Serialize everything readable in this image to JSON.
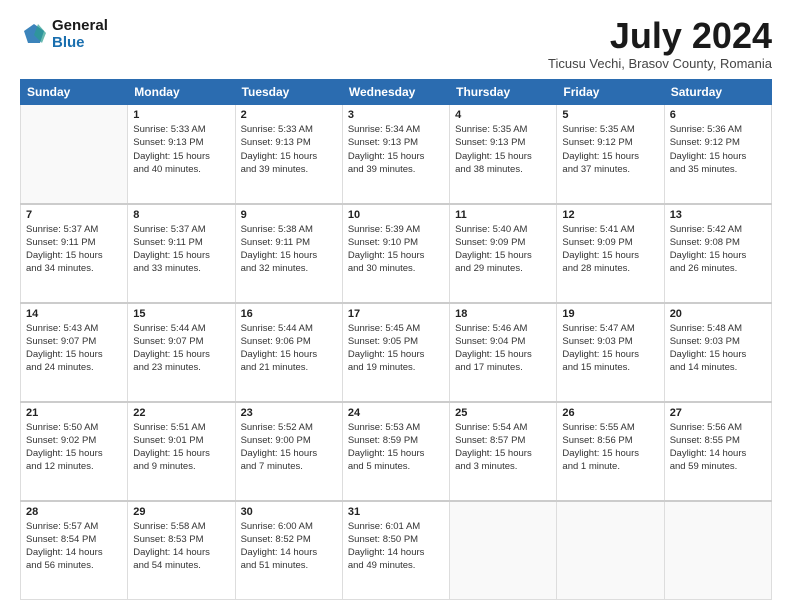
{
  "logo": {
    "general": "General",
    "blue": "Blue"
  },
  "title": "July 2024",
  "location": "Ticusu Vechi, Brasov County, Romania",
  "days_of_week": [
    "Sunday",
    "Monday",
    "Tuesday",
    "Wednesday",
    "Thursday",
    "Friday",
    "Saturday"
  ],
  "weeks": [
    [
      {
        "day": "",
        "content": ""
      },
      {
        "day": "1",
        "content": "Sunrise: 5:33 AM\nSunset: 9:13 PM\nDaylight: 15 hours\nand 40 minutes."
      },
      {
        "day": "2",
        "content": "Sunrise: 5:33 AM\nSunset: 9:13 PM\nDaylight: 15 hours\nand 39 minutes."
      },
      {
        "day": "3",
        "content": "Sunrise: 5:34 AM\nSunset: 9:13 PM\nDaylight: 15 hours\nand 39 minutes."
      },
      {
        "day": "4",
        "content": "Sunrise: 5:35 AM\nSunset: 9:13 PM\nDaylight: 15 hours\nand 38 minutes."
      },
      {
        "day": "5",
        "content": "Sunrise: 5:35 AM\nSunset: 9:12 PM\nDaylight: 15 hours\nand 37 minutes."
      },
      {
        "day": "6",
        "content": "Sunrise: 5:36 AM\nSunset: 9:12 PM\nDaylight: 15 hours\nand 35 minutes."
      }
    ],
    [
      {
        "day": "7",
        "content": "Sunrise: 5:37 AM\nSunset: 9:11 PM\nDaylight: 15 hours\nand 34 minutes."
      },
      {
        "day": "8",
        "content": "Sunrise: 5:37 AM\nSunset: 9:11 PM\nDaylight: 15 hours\nand 33 minutes."
      },
      {
        "day": "9",
        "content": "Sunrise: 5:38 AM\nSunset: 9:11 PM\nDaylight: 15 hours\nand 32 minutes."
      },
      {
        "day": "10",
        "content": "Sunrise: 5:39 AM\nSunset: 9:10 PM\nDaylight: 15 hours\nand 30 minutes."
      },
      {
        "day": "11",
        "content": "Sunrise: 5:40 AM\nSunset: 9:09 PM\nDaylight: 15 hours\nand 29 minutes."
      },
      {
        "day": "12",
        "content": "Sunrise: 5:41 AM\nSunset: 9:09 PM\nDaylight: 15 hours\nand 28 minutes."
      },
      {
        "day": "13",
        "content": "Sunrise: 5:42 AM\nSunset: 9:08 PM\nDaylight: 15 hours\nand 26 minutes."
      }
    ],
    [
      {
        "day": "14",
        "content": "Sunrise: 5:43 AM\nSunset: 9:07 PM\nDaylight: 15 hours\nand 24 minutes."
      },
      {
        "day": "15",
        "content": "Sunrise: 5:44 AM\nSunset: 9:07 PM\nDaylight: 15 hours\nand 23 minutes."
      },
      {
        "day": "16",
        "content": "Sunrise: 5:44 AM\nSunset: 9:06 PM\nDaylight: 15 hours\nand 21 minutes."
      },
      {
        "day": "17",
        "content": "Sunrise: 5:45 AM\nSunset: 9:05 PM\nDaylight: 15 hours\nand 19 minutes."
      },
      {
        "day": "18",
        "content": "Sunrise: 5:46 AM\nSunset: 9:04 PM\nDaylight: 15 hours\nand 17 minutes."
      },
      {
        "day": "19",
        "content": "Sunrise: 5:47 AM\nSunset: 9:03 PM\nDaylight: 15 hours\nand 15 minutes."
      },
      {
        "day": "20",
        "content": "Sunrise: 5:48 AM\nSunset: 9:03 PM\nDaylight: 15 hours\nand 14 minutes."
      }
    ],
    [
      {
        "day": "21",
        "content": "Sunrise: 5:50 AM\nSunset: 9:02 PM\nDaylight: 15 hours\nand 12 minutes."
      },
      {
        "day": "22",
        "content": "Sunrise: 5:51 AM\nSunset: 9:01 PM\nDaylight: 15 hours\nand 9 minutes."
      },
      {
        "day": "23",
        "content": "Sunrise: 5:52 AM\nSunset: 9:00 PM\nDaylight: 15 hours\nand 7 minutes."
      },
      {
        "day": "24",
        "content": "Sunrise: 5:53 AM\nSunset: 8:59 PM\nDaylight: 15 hours\nand 5 minutes."
      },
      {
        "day": "25",
        "content": "Sunrise: 5:54 AM\nSunset: 8:57 PM\nDaylight: 15 hours\nand 3 minutes."
      },
      {
        "day": "26",
        "content": "Sunrise: 5:55 AM\nSunset: 8:56 PM\nDaylight: 15 hours\nand 1 minute."
      },
      {
        "day": "27",
        "content": "Sunrise: 5:56 AM\nSunset: 8:55 PM\nDaylight: 14 hours\nand 59 minutes."
      }
    ],
    [
      {
        "day": "28",
        "content": "Sunrise: 5:57 AM\nSunset: 8:54 PM\nDaylight: 14 hours\nand 56 minutes."
      },
      {
        "day": "29",
        "content": "Sunrise: 5:58 AM\nSunset: 8:53 PM\nDaylight: 14 hours\nand 54 minutes."
      },
      {
        "day": "30",
        "content": "Sunrise: 6:00 AM\nSunset: 8:52 PM\nDaylight: 14 hours\nand 51 minutes."
      },
      {
        "day": "31",
        "content": "Sunrise: 6:01 AM\nSunset: 8:50 PM\nDaylight: 14 hours\nand 49 minutes."
      },
      {
        "day": "",
        "content": ""
      },
      {
        "day": "",
        "content": ""
      },
      {
        "day": "",
        "content": ""
      }
    ]
  ]
}
